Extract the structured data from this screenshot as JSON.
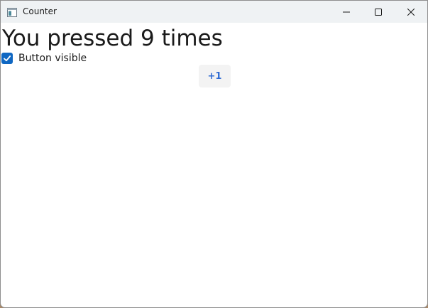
{
  "window": {
    "title": "Counter",
    "icon": "app-window-icon",
    "controls": {
      "minimize_icon": "minimize-icon",
      "maximize_icon": "maximize-icon",
      "close_icon": "close-icon"
    }
  },
  "main": {
    "counter_text": "You pressed 9 times",
    "checkbox": {
      "label": "Button visible",
      "checked": true
    },
    "increment_button_label": "+1"
  },
  "colors": {
    "accent": "#0f67c2",
    "button_text": "#2f6bd3",
    "titlebar": "#eff2f4"
  }
}
